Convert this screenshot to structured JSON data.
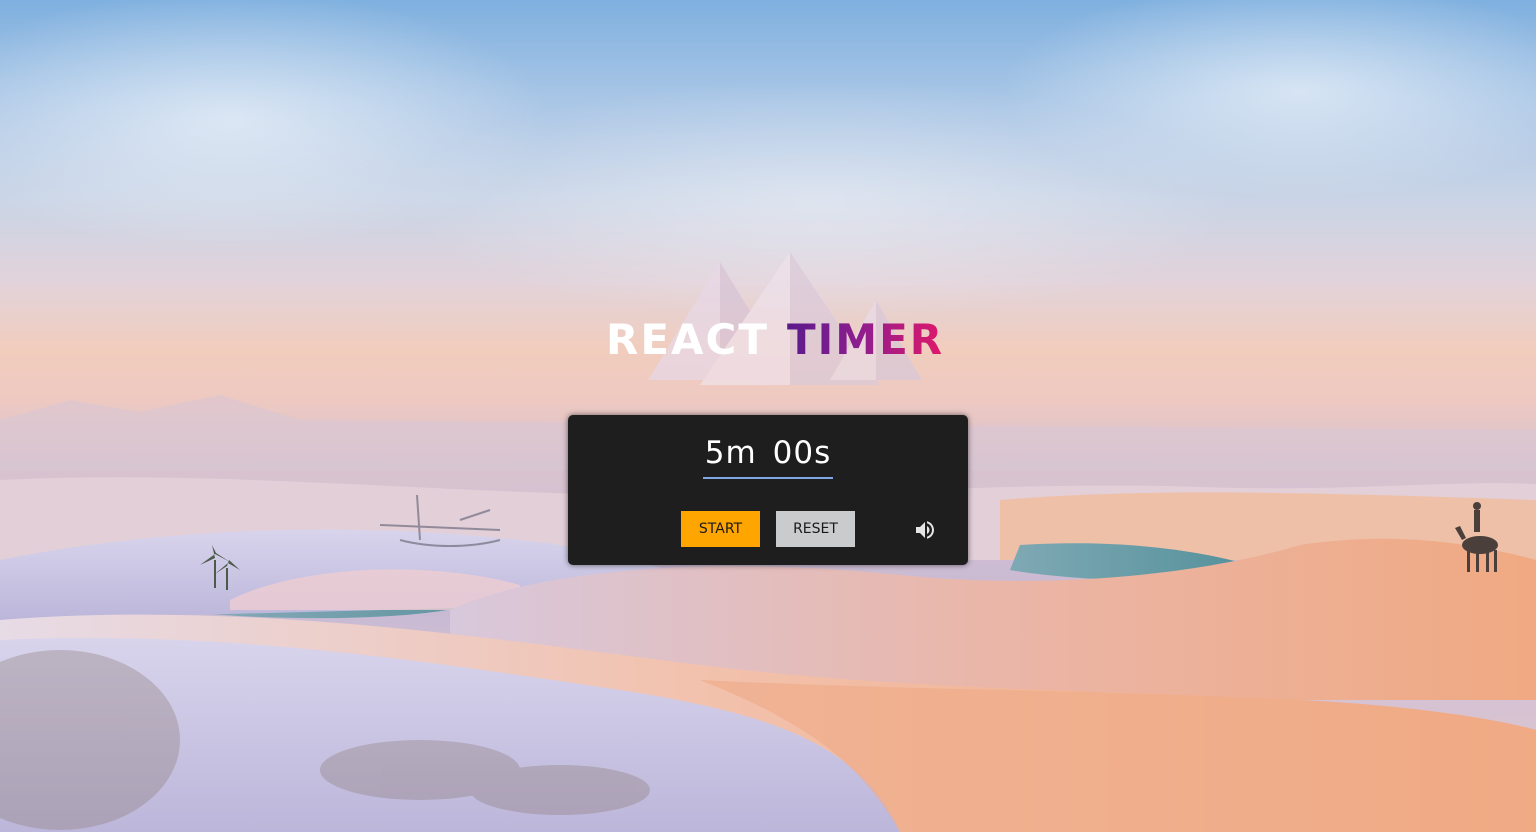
{
  "app": {
    "logo": {
      "word1": "REACT",
      "word2": "TIMER"
    }
  },
  "timer": {
    "minutes": "5m",
    "seconds": "00s"
  },
  "controls": {
    "start_label": "START",
    "reset_label": "RESET",
    "sound_icon": "volume-icon"
  },
  "colors": {
    "start_button": "#ffa500",
    "reset_button": "#c9cbcd",
    "panel": "#1e1e1e",
    "underline": "#7fa7e6",
    "logo_gradient_start": "#5a1a8c",
    "logo_gradient_end": "#e0186a"
  }
}
